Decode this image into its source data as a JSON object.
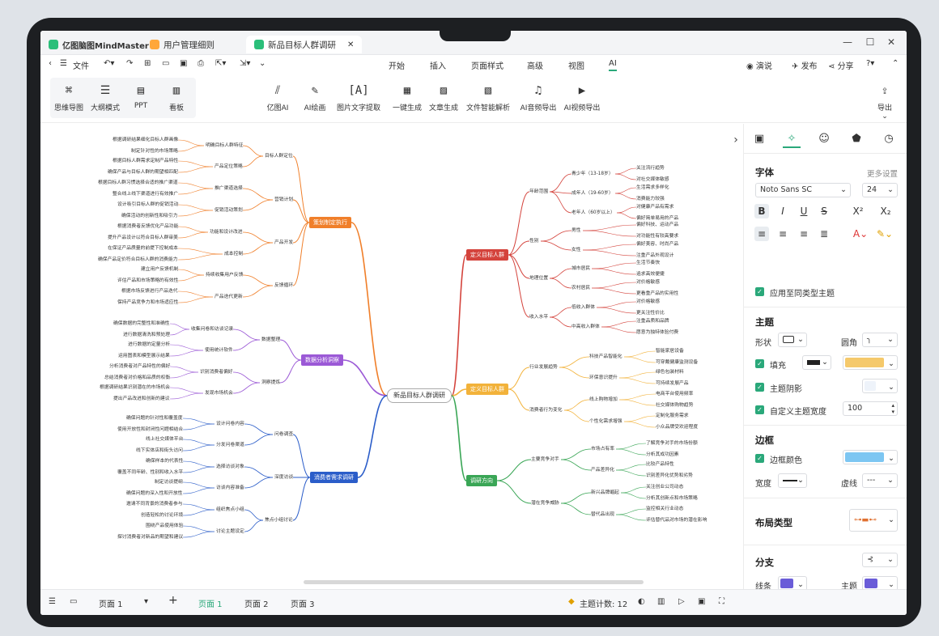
{
  "app": {
    "name": "亿图脑图MindMaster",
    "tabs": [
      "用户管理细则",
      "新品目标人群调研"
    ]
  },
  "menu": {
    "file": "文件",
    "tabs": [
      "开始",
      "插入",
      "页面样式",
      "高级",
      "视图",
      "AI"
    ],
    "active_tab": "AI",
    "right": [
      "演说",
      "发布",
      "分享"
    ]
  },
  "toolbar": {
    "views": [
      "思维导图",
      "大纲模式",
      "PPT",
      "看板"
    ],
    "ai_tools": [
      "亿图AI",
      "AI绘画",
      "图片文字提取",
      "一键生成",
      "文章生成",
      "文件智能解析",
      "AI音频导出",
      "AI视频导出"
    ],
    "export": "导出"
  },
  "panel": {
    "font_title": "字体",
    "more_settings": "更多设置",
    "font_name": "Noto Sans SC",
    "font_size": "24",
    "apply_same": "应用至同类型主题",
    "topic_title": "主题",
    "shape": "形状",
    "corner": "圆角",
    "fill": "填充",
    "shadow": "主题阴影",
    "custom_width": "自定义主题宽度",
    "width_value": "100",
    "border_title": "边框",
    "border_color": "边框颜色",
    "width": "宽度",
    "dash": "虚线",
    "layout_title": "布局类型",
    "branch_title": "分支",
    "line": "线条",
    "topic": "主题",
    "width2": "宽度",
    "dash2": "虚线",
    "colors": {
      "fill": "#f5c96b",
      "border": "#7dc6f2",
      "line": "#6a5cd8",
      "topic": "#6a5cd8",
      "accent": "#2aa87a"
    }
  },
  "status": {
    "page_selector": "页面 1",
    "pages": [
      "页面 1",
      "页面 2",
      "页面 3"
    ],
    "active_page": "页面 1",
    "topic_count": "主题计数: 12"
  },
  "mindmap": {
    "root": "新品目标人群调研",
    "b1": {
      "label": "策划制定执行",
      "c1": "目标人群定位",
      "c1a": "明确目标人群特征",
      "c1a_l": [
        "根据调研结果细化目标人群画像",
        "制定针对性的市场策略"
      ],
      "c1b": "产品定位策略",
      "c1b_l": [
        "根据目标人群需求定制产品特性",
        "确保产品与目标人群的期望相匹配"
      ],
      "c2": "营销计划",
      "c2a": "推广渠道选择",
      "c2a_l": [
        "根据目标人群习惯选择合适的推广渠道",
        "整合线上线下渠道进行有效推广"
      ],
      "c2b": "促销活动策划",
      "c2b_l": [
        "设计吸引目标人群的促销活动",
        "确保活动的创新性和吸引力"
      ],
      "c3": "产品开发",
      "c3a": "功能和设计改进",
      "c3a_l": [
        "根据消费者反馈优化产品功能",
        "提升产品设计以符合目标人群审美"
      ],
      "c3b": "成本控制",
      "c3b_l": [
        "在保证产品质量的前提下控制成本",
        "确保产品定价符合目标人群的消费能力"
      ],
      "c4": "反馈循环",
      "c4a": "持续收集用户反馈",
      "c4a_l": [
        "建立用户反馈机制",
        "评估产品和市场策略的有效性"
      ],
      "c4b": "产品迭代更新",
      "c4b_l": [
        "根据市场反馈进行产品迭代",
        "保持产品竞争力和市场适应性"
      ]
    },
    "b2": {
      "label": "数据分析洞察",
      "c1": "数据整理",
      "c1a": "收集问卷和访谈记录",
      "c1a_l": [
        "确保数据的完整性和准确性",
        "进行数据清洗和预处理"
      ],
      "c1b": "使用统计软件",
      "c1b_l": [
        "进行数据的定量分析",
        "运用图表和模型展示结果"
      ],
      "c2": "洞察提炼",
      "c2a": "识别消费者偏好",
      "c2a_l": [
        "分析消费者对产品特性的偏好",
        "总结消费者对价格和品质的权衡"
      ],
      "c2b": "发现市场机会",
      "c2b_l": [
        "根据调研结果识别潜在的市场机会",
        "提出产品改进和创新的建议"
      ]
    },
    "b3": {
      "label": "消费者需求调研",
      "c1": "问卷调查",
      "c1a": "设计问卷内容",
      "c1a_l": [
        "确保问题的针对性和覆盖度",
        "使用开放性和封闭性问题相结合"
      ],
      "c1b": "分发问卷渠道",
      "c1b_l": [
        "线上社交媒体平台",
        "线下实体店和街头访问"
      ],
      "c2": "深度访谈",
      "c2a": "选择访谈对象",
      "c2a_l": [
        "确保样本的代表性",
        "覆盖不同年龄、性别和收入水平"
      ],
      "c2b": "访谈内容准备",
      "c2b_l": [
        "制定访谈提纲",
        "确保问题的深入性和开放性"
      ],
      "c3": "焦点小组讨论",
      "c3a": "组织焦点小组",
      "c3a_l": [
        "邀请不同背景的消费者参与",
        "创造轻松的讨论环境"
      ],
      "c3b": "讨论主题设定",
      "c3b_l": [
        "围绕产品使用体验",
        "探讨消费者对新品的期望和建议"
      ]
    },
    "r1": {
      "label": "定义目标人群",
      "c1": "年龄范围",
      "c1a": "青少年（13-18岁）",
      "c1a_l": [
        "关注流行趋势",
        "对社交媒体敏感"
      ],
      "c1b": "成年人（19-60岁）",
      "c1b_l": [
        "生活需求多样化",
        "消费能力较强"
      ],
      "c1c": "老年人（60岁以上）",
      "c1c_l": [
        "对健康产品有需求",
        "偏好简单易用的产品"
      ],
      "c2": "性别",
      "c2a": "男性",
      "c2a_l": [
        "偏好科技、运动产品",
        "对功能性有较高要求"
      ],
      "c2b": "女性",
      "c2b_l": [
        "偏好美容、时尚产品",
        "注重产品外观设计"
      ],
      "c3": "地理位置",
      "c3a": "城市居民",
      "c3a_l": [
        "生活节奏快",
        "追求高效便捷"
      ],
      "c3b": "农村居民",
      "c3b_l": [
        "对价格敏感",
        "更看重产品的实用性"
      ],
      "c4": "收入水平",
      "c4a": "低收入群体",
      "c4a_l": [
        "对价格敏感",
        "更关注性价比"
      ],
      "c4b": "中高收入群体",
      "c4b_l": [
        "注重品质和品牌",
        "愿意为独特体验付费"
      ]
    },
    "r2": {
      "label": "定义目标人群",
      "c1": "行业发展趋势",
      "c1a": "科技产品智能化",
      "c1a_l": [
        "智能家居设备",
        "可穿戴健康监测设备"
      ],
      "c1b": "环保意识提升",
      "c1b_l": [
        "绿色包装材料",
        "可持续发展产品"
      ],
      "c2": "消费者行为变化",
      "c2a": "线上购物增加",
      "c2a_l": [
        "电商平台使用频率",
        "社交媒体购物趋势"
      ],
      "c2b": "个性化需求增强",
      "c2b_l": [
        "定制化服务需求",
        "小众品牌受欢迎程度"
      ]
    },
    "r3": {
      "label": "调研方向",
      "c1": "主要竞争对手",
      "c1a": "市场占有率",
      "c1a_l": [
        "了解竞争对手的市场份额",
        "分析其成功因素"
      ],
      "c1b": "产品差异化",
      "c1b_l": [
        "比较产品特性",
        "识别差异化优势和劣势"
      ],
      "c2": "潜在竞争威胁",
      "c2a": "新兴品牌崛起",
      "c2a_l": [
        "关注创业公司动态",
        "分析其创新点和市场策略"
      ],
      "c2b": "替代品出现",
      "c2b_l": [
        "监控相关行业动态",
        "评估替代品对市场的潜在影响"
      ]
    }
  }
}
